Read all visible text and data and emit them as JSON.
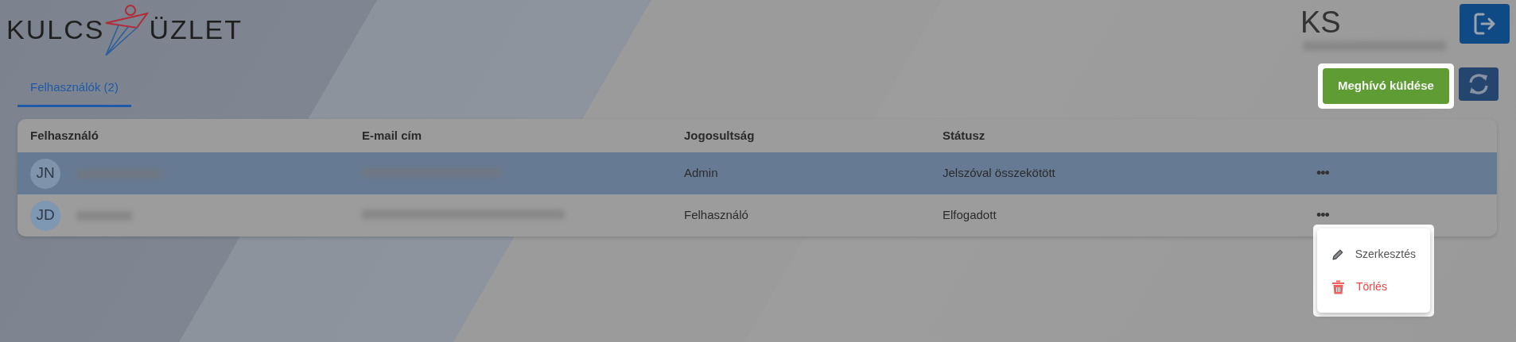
{
  "logo": {
    "left": "KULCS",
    "right": "ÜZLET"
  },
  "user": {
    "initials": "KS",
    "email_blurred": true
  },
  "tabs": [
    {
      "label": "Felhasználók (2)",
      "selected": true
    }
  ],
  "actions": {
    "invite": "Meghívó küldése",
    "invite_highlighted": true
  },
  "table": {
    "columns": [
      "Felhasználó",
      "E-mail cím",
      "Jogosultság",
      "Státusz"
    ],
    "rows": [
      {
        "initials": "JN",
        "name_blurred": true,
        "email_blurred": true,
        "role": "Admin",
        "status": "Jelszóval összekötött",
        "menu": "•••",
        "selected": true
      },
      {
        "initials": "JD",
        "name_blurred": true,
        "email_blurred": true,
        "role": "Felhasználó",
        "status": "Elfogadott",
        "menu": "•••",
        "selected": false
      }
    ]
  },
  "context_menu": {
    "items": [
      {
        "kind": "edit",
        "label": "Szerkesztés"
      },
      {
        "kind": "delete",
        "label": "Törlés"
      }
    ]
  }
}
